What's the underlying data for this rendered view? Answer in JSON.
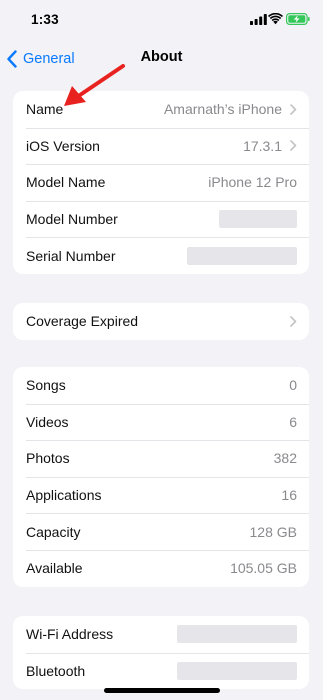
{
  "status_bar": {
    "time": "1:33"
  },
  "nav": {
    "back_label": "General",
    "title": "About"
  },
  "group1": [
    {
      "label": "Name",
      "value": "Amarnath’s iPhone"
    },
    {
      "label": "iOS Version",
      "value": "17.3.1"
    },
    {
      "label": "Model Name",
      "value": "iPhone 12 Pro"
    },
    {
      "label": "Model Number"
    },
    {
      "label": "Serial Number"
    }
  ],
  "group2": [
    {
      "label": "Coverage Expired"
    }
  ],
  "group3": [
    {
      "label": "Songs",
      "value": "0"
    },
    {
      "label": "Videos",
      "value": "6"
    },
    {
      "label": "Photos",
      "value": "382"
    },
    {
      "label": "Applications",
      "value": "16"
    },
    {
      "label": "Capacity",
      "value": "128 GB"
    },
    {
      "label": "Available",
      "value": "105.05 GB"
    }
  ],
  "group4": [
    {
      "label": "Wi-Fi Address"
    },
    {
      "label": "Bluetooth"
    }
  ],
  "colors": {
    "accent": "#0a7aff",
    "annotation_arrow": "#e8231f",
    "battery_charging": "#34c759"
  },
  "icons": [
    "cellular-signal-icon",
    "wifi-icon",
    "battery-charging-icon",
    "back-chevron-icon",
    "chevron-right-icon",
    "annotation-arrow"
  ]
}
